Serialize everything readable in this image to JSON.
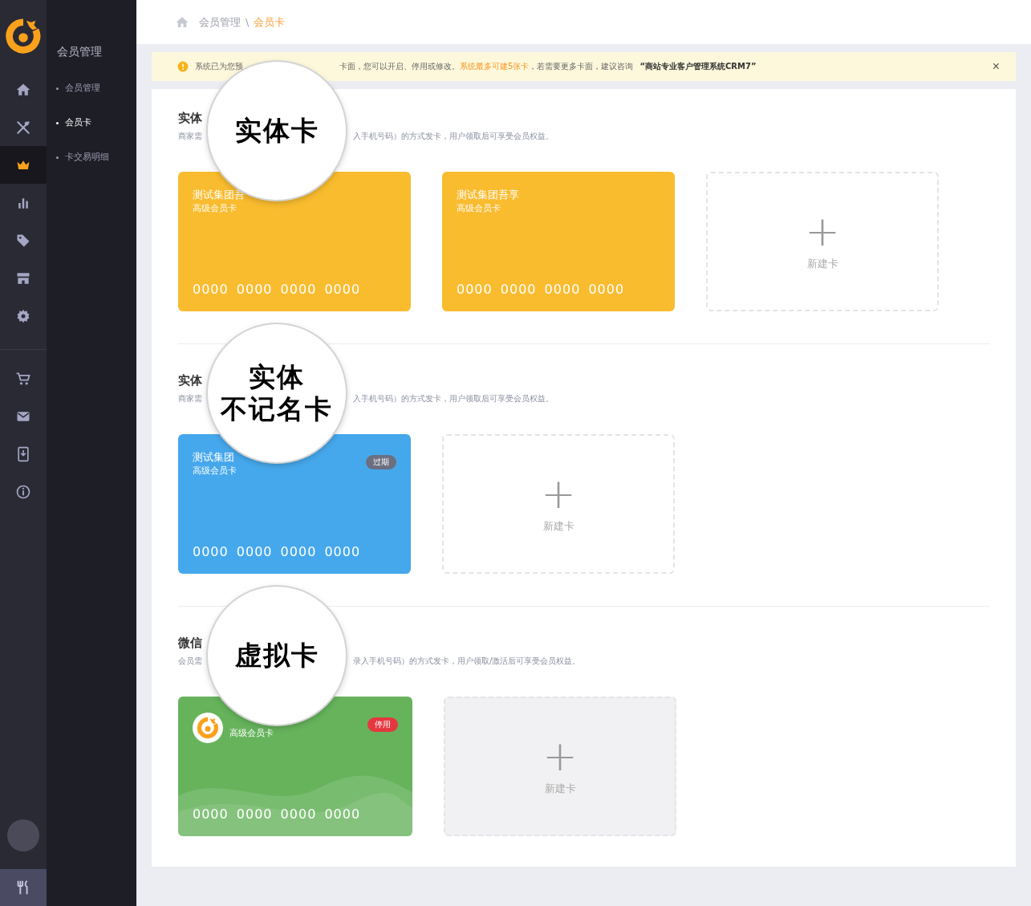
{
  "sidebar": {
    "icons": [
      {
        "selected": false
      },
      {
        "selected": false
      },
      {
        "selected": true
      },
      {
        "selected": false
      },
      {
        "selected": false
      },
      {
        "selected": false
      },
      {
        "selected": false
      },
      {
        "selected": false
      },
      {
        "selected": false
      },
      {
        "selected": false
      },
      {
        "selected": false
      }
    ],
    "submenu_title": "会员管理",
    "submenu": [
      {
        "label": "会员管理",
        "selected": false
      },
      {
        "label": "会员卡",
        "selected": true
      },
      {
        "label": "卡交易明细",
        "selected": false
      }
    ]
  },
  "breadcrumb": [
    {
      "label": "会员管理",
      "current": false
    },
    {
      "label": "会员卡",
      "current": true
    }
  ],
  "breadcrumb_separator": "\\",
  "notice": {
    "before": "系统已为您预",
    "segments": [
      {
        "kind": "plain",
        "text": "卡面，您可以开启、停用或修改。"
      },
      {
        "kind": "highlight",
        "text": "系统最多可建5张卡"
      },
      {
        "kind": "plain",
        "text": "，若需要更多卡面，建议咨询"
      },
      {
        "kind": "strong",
        "text": "“商站专业客户管理系统CRM7”"
      }
    ],
    "close": "×"
  },
  "sections": [
    {
      "title": "实体",
      "description_start": "商家需",
      "description_end": "入手机号码）的方式发卡，用户领取后可享受会员权益。",
      "callout": [
        "实体卡"
      ],
      "cards": [
        {
          "kind": "card",
          "color": "#f9bc2f",
          "name": "测试集团吾",
          "level": "高级会员卡",
          "number": "0000 0000 0000 0000"
        },
        {
          "kind": "card",
          "color": "#f9bc2f",
          "name": "测试集团吾享",
          "level": "高级会员卡",
          "number": "0000 0000 0000 0000"
        },
        {
          "kind": "new",
          "plus": "+",
          "label": "新建卡",
          "shaded": false
        }
      ]
    },
    {
      "title": "实体",
      "description_start": "商家需",
      "description_end": "入手机号码）的方式发卡，用户领取后可享受会员权益。",
      "callout": [
        "实体",
        "不记名卡"
      ],
      "cards": [
        {
          "kind": "card",
          "color": "#46a8ec",
          "name": "测试集团",
          "level": "高级会员卡",
          "number": "0000 0000 0000 0000",
          "badge": {
            "text": "过期",
            "color": "#6b6f80"
          }
        },
        {
          "kind": "new",
          "plus": "+",
          "label": "新建卡",
          "shaded": false
        }
      ]
    },
    {
      "title": "微信",
      "description_start": "会员需",
      "description_end": "录入手机号码）的方式发卡，用户领取/激活后可享受会员权益。",
      "callout": [
        "虚拟卡"
      ],
      "cards": [
        {
          "kind": "wechat",
          "color": "#66b35c",
          "level": "高级会员卡",
          "number": "0000 0000 0000 0000",
          "badge": {
            "text": "停用",
            "color": "#e5373f"
          }
        },
        {
          "kind": "new",
          "plus": "+",
          "label": "新建卡",
          "shaded": true
        }
      ]
    }
  ]
}
